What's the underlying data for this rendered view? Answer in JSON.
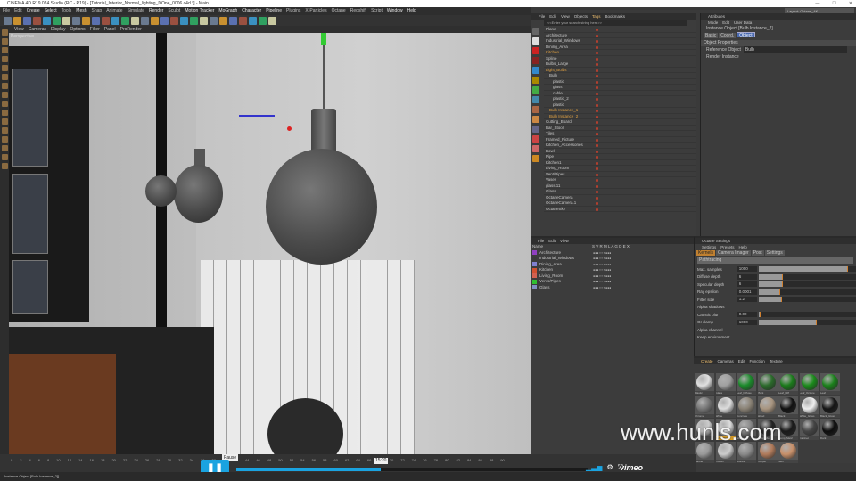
{
  "window": {
    "title": "CINEMA 4D R19.024 Studio (RC - R19) - [Tutorial_Interior_Normal_lighting_DOne_0006.c4d *] - Main",
    "controls": [
      "—",
      "☐",
      "✕"
    ]
  },
  "menu": [
    "File",
    "Edit",
    "Create",
    "Select",
    "Tools",
    "Mesh",
    "Snap",
    "Animate",
    "Simulate",
    "Render",
    "Sculpt",
    "Motion Tracker",
    "MoGraph",
    "Character",
    "Pipeline",
    "Plugins",
    "X-Particles",
    "Octane",
    "Redshift",
    "Script",
    "Window",
    "Help"
  ],
  "layout": {
    "label": "Layout:",
    "value": "Octane_4K"
  },
  "viewport": {
    "menu": [
      "View",
      "Cameras",
      "Display",
      "Options",
      "Filter",
      "Panel",
      "ProRender"
    ],
    "label": "Perspective"
  },
  "object_manager": {
    "menu": [
      "File",
      "Edit",
      "View",
      "Objects",
      "Tags",
      "Bookmarks"
    ],
    "search_placeholder": "<<Enter your search string here>>",
    "objects": [
      "Plane",
      "Architecture",
      "Industrial_Windows",
      "Dining_Area",
      "Kitchen",
      "Spline",
      "Bulbs_Large",
      "Light_Bulbs",
      "Bulb",
      "plastic",
      "glass",
      "cable",
      "plastic_2",
      "plastic",
      "Bulb Instance_1",
      "Bulb Instance_2",
      "Cutting_Board",
      "Bar_Stool",
      "Tiles",
      "Framed_Picture",
      "Kitchen_Accessories",
      "Bowl",
      "Pipe",
      "Kitchen1",
      "Living_Room",
      "Vent/Pipes",
      "Vases",
      "glass.11",
      "Glass",
      "OctaneCamera",
      "OctaneCamera.1",
      "OctaneSky"
    ]
  },
  "attributes": {
    "title": "Attributes",
    "menu": [
      "Mode",
      "Edit",
      "User Data"
    ],
    "object_name": "Instance Object [Bulb Instance_2]",
    "tabs": [
      "Basic",
      "Coord.",
      "Object"
    ],
    "active_tab": "Object",
    "section": "Object Properties",
    "reference_label": "Reference Object",
    "reference_value": "Bulb",
    "render_instance_label": "Render Instance"
  },
  "layers": {
    "menu": [
      "File",
      "Edit",
      "View"
    ],
    "name_header": "Name",
    "columns": "S V R M L A G D E X",
    "items": [
      {
        "name": "Architecture",
        "color": "#9040c0"
      },
      {
        "name": "Industrial_Windows",
        "color": "#3a3a3a"
      },
      {
        "name": "Dining_Area",
        "color": "#8080d0"
      },
      {
        "name": "Kitchen",
        "color": "#d05030"
      },
      {
        "name": "Living_Room",
        "color": "#d06050"
      },
      {
        "name": "Vents/Pipes",
        "color": "#30c030"
      },
      {
        "name": "Glass",
        "color": "#8090c0"
      }
    ]
  },
  "octane_settings": {
    "title": "Octane Settings",
    "menu": [
      "Settings",
      "Presets",
      "Help"
    ],
    "tabs": [
      "Kernels",
      "Camera Imager",
      "Post",
      "Settings"
    ],
    "kernel": "Pathtracing",
    "params": [
      {
        "label": "Max. samples",
        "value": "1000",
        "fraction": 0.92
      },
      {
        "label": "Diffuse depth",
        "value": "6",
        "fraction": 0.25
      },
      {
        "label": "Specular depth",
        "value": "6",
        "fraction": 0.25
      },
      {
        "label": "Ray epsilon",
        "value": "0.0001",
        "fraction": 0.22
      },
      {
        "label": "Filter size",
        "value": "1.2",
        "fraction": 0.24
      },
      {
        "label": "Caustic blur",
        "value": "0.02",
        "fraction": 0.02
      },
      {
        "label": "GI clamp",
        "value": "1000",
        "fraction": 0.6
      }
    ],
    "checks": [
      "Alpha shadows",
      "Alpha channel",
      "Keep environment"
    ]
  },
  "material_manager": {
    "menu": [
      "Create",
      "Cameras",
      "Edit",
      "Function",
      "Texture"
    ],
    "materials": [
      {
        "name": "Plastic",
        "color": "#e0e0e0"
      },
      {
        "name": "Glass",
        "color": "#a0a0a0"
      },
      {
        "name": "Leaf_Diffuse",
        "color": "#1a8a2a"
      },
      {
        "name": "Plant",
        "color": "#2a6a2a"
      },
      {
        "name": "Leaf_Diff",
        "color": "#1a7a1a"
      },
      {
        "name": "Leaf_Octane",
        "color": "#1a8a1a"
      },
      {
        "name": "Leaf",
        "color": "#1a801a"
      },
      {
        "name": "Chrome",
        "color": "#777"
      },
      {
        "name": "White",
        "color": "#ddd"
      },
      {
        "name": "Concrete",
        "color": "#8a8275"
      },
      {
        "name": "Wood",
        "color": "#a89580"
      },
      {
        "name": "Black",
        "color": "#111"
      },
      {
        "name": "White_Gloss",
        "color": "#eee"
      },
      {
        "name": "Black_Gloss",
        "color": "#151515"
      },
      {
        "name": "Tiles",
        "color": "#ccc"
      },
      {
        "name": "Bulb_glass",
        "color": "#ddd"
      },
      {
        "name": "Stone",
        "color": "#888"
      },
      {
        "name": "Lamp_Met",
        "color": "#222"
      },
      {
        "name": "Lamp_Met2",
        "color": "#1a1a1a"
      },
      {
        "name": "Cabinet",
        "color": "#444"
      },
      {
        "name": "Dark",
        "color": "#0d0d0d"
      },
      {
        "name": "Marble",
        "color": "#999"
      },
      {
        "name": "Plaster",
        "color": "#ccc"
      },
      {
        "name": "Stone2",
        "color": "#8a8a8a"
      },
      {
        "name": "Copper",
        "color": "#b07a5a"
      },
      {
        "name": "Skin",
        "color": "#c8906a"
      }
    ],
    "selected": "Bulb_glass"
  },
  "timeline": {
    "ticks": [
      "0",
      "2",
      "4",
      "6",
      "8",
      "10",
      "12",
      "14",
      "16",
      "18",
      "20",
      "22",
      "24",
      "26",
      "28",
      "30",
      "32",
      "34",
      "36",
      "38",
      "40",
      "42",
      "44",
      "46",
      "48",
      "50",
      "52",
      "54",
      "56",
      "58",
      "60",
      "62",
      "64",
      "66",
      "68",
      "70",
      "72",
      "74",
      "76",
      "78",
      "80",
      "82",
      "84",
      "86",
      "88",
      "90"
    ]
  },
  "status": "[Instance Object [Bulb Instance_2]]",
  "player": {
    "pause_tooltip": "Pause",
    "time": "15:20",
    "progress": 0.41,
    "brand": "vimeo"
  },
  "watermark": "www.hunls.com"
}
